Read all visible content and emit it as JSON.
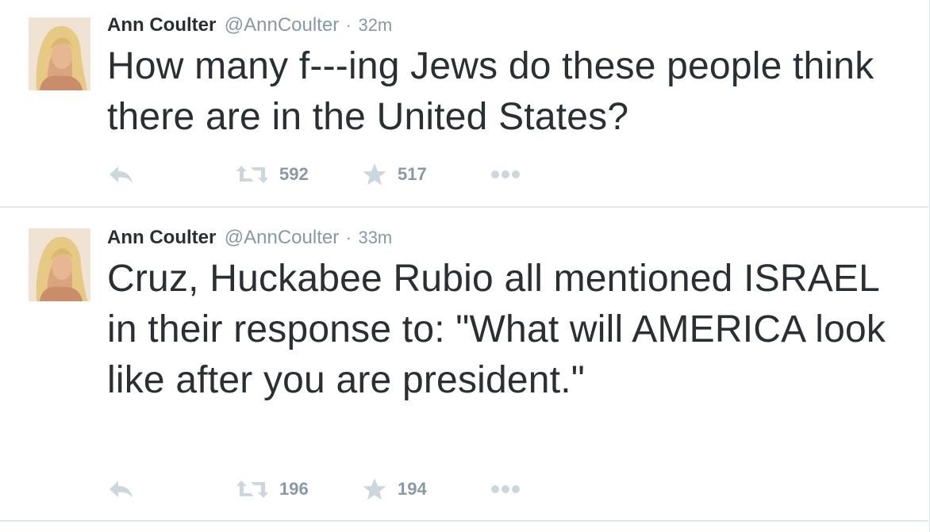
{
  "tweets": [
    {
      "author": "Ann Coulter",
      "handle": "@AnnCoulter",
      "separator": "·",
      "time": "32m",
      "text": "How many f---ing Jews do these people think there are in the United States?",
      "retweets": "592",
      "favorites": "517"
    },
    {
      "author": "Ann Coulter",
      "handle": "@AnnCoulter",
      "separator": "·",
      "time": "33m",
      "text": "Cruz, Huckabee Rubio all mentioned ISRAEL in their response to: \"What will AMERICA look like after you are president.\"",
      "retweets": "196",
      "favorites": "194"
    }
  ],
  "icons": {
    "reply": "reply-icon",
    "retweet": "retweet-icon",
    "favorite": "star-icon",
    "more": "more-dots-icon"
  },
  "colors": {
    "name": "#292f33",
    "muted": "#8899a6",
    "icon": "#ccd6dd",
    "divider": "#e1e8ed"
  }
}
